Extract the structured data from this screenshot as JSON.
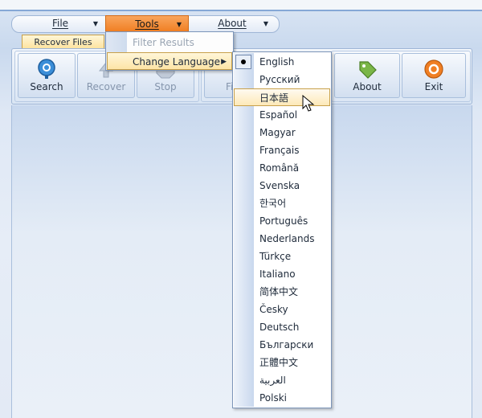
{
  "menubar": {
    "items": [
      {
        "label": "File",
        "expanded": false
      },
      {
        "label": "Tools",
        "expanded": true
      },
      {
        "label": "About",
        "expanded": false
      }
    ]
  },
  "ribbon": {
    "tab_label": "Recover Files",
    "buttons": [
      {
        "label": "Search",
        "icon": "search-icon",
        "enabled": true
      },
      {
        "label": "Recover",
        "icon": "recover-icon",
        "enabled": false
      },
      {
        "label": "Stop",
        "icon": "stop-icon",
        "enabled": false
      },
      {
        "label": "Fi",
        "icon": "filter-icon",
        "enabled": false
      },
      {
        "label": "About",
        "icon": "tag-icon",
        "enabled": true
      },
      {
        "label": "Exit",
        "icon": "exit-icon",
        "enabled": true
      }
    ]
  },
  "tools_menu": {
    "items": [
      {
        "label": "Filter Results",
        "enabled": false
      },
      {
        "label": "Change Language",
        "enabled": true,
        "has_submenu": true
      }
    ]
  },
  "language_menu": {
    "selected": "English",
    "hovered": "日本語",
    "items": [
      "English",
      "Русский",
      "日本語",
      "Español",
      "Magyar",
      "Français",
      "Română",
      "Svenska",
      "한국어",
      "Português",
      "Nederlands",
      "Türkçe",
      "Italiano",
      "简体中文",
      "Česky",
      "Deutsch",
      "Български",
      "正體中文",
      "العربية",
      "Polski"
    ]
  },
  "colors": {
    "menu_active": "#f07f24",
    "highlight": "#fde4a6",
    "frame": "#86a8d6"
  }
}
